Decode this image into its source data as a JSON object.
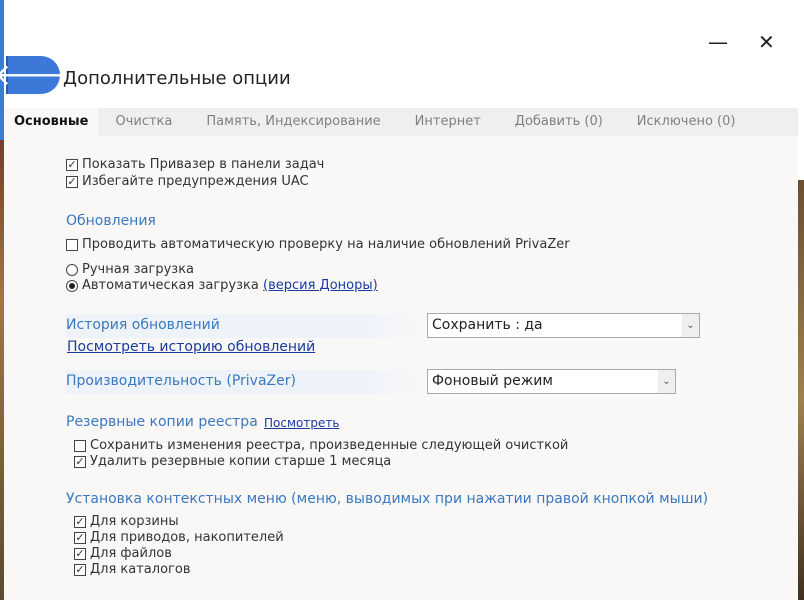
{
  "window": {
    "title": "Дополнительные опции",
    "minimize": "—",
    "close": "✕",
    "back_icon": "🡐"
  },
  "tabs": [
    "Основные",
    "Очистка",
    "Память, Индексирование",
    "Интернет",
    "Добавить (0)",
    "Исключено (0)"
  ],
  "general": {
    "show_taskbar": "Показать Привазер в панели задач",
    "avoid_uac": "Избегайте предупреждения UAC"
  },
  "updates": {
    "heading": "Обновления",
    "auto_check": "Проводить автоматическую проверку на наличие обновлений PrivaZer",
    "manual": "Ручная загрузка",
    "automatic": "Автоматическая загрузка",
    "donor_link": "(версия Доноры)"
  },
  "history": {
    "label": "История обновлений",
    "select_value": "Сохранить : да",
    "view_link": "Посмотреть историю обновлений"
  },
  "performance": {
    "label": "Производительность (PrivaZer)",
    "select_value": "Фоновый режим"
  },
  "registry": {
    "heading": "Резервные копии реестра",
    "view_link": "Посмотреть",
    "save_changes": "Сохранить изменения реестра, произведенные следующей очисткой",
    "delete_old": "Удалить резервные копии старше 1 месяца"
  },
  "context": {
    "heading": "Установка контекстных меню (меню, выводимых при нажатии правой кнопкой мыши)",
    "items": [
      "Для корзины",
      "Для приводов, накопителей",
      "Для файлов",
      "Для каталогов"
    ]
  }
}
